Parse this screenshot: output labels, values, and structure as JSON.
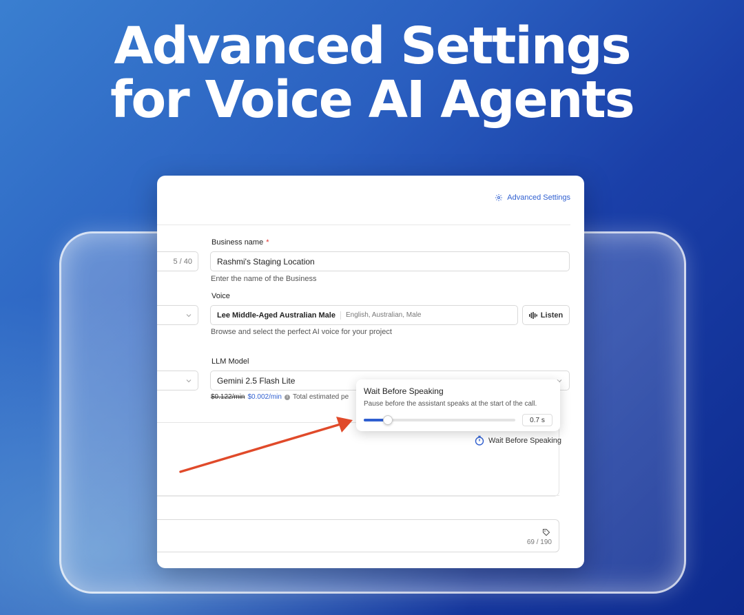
{
  "headline": {
    "line1": "Advanced Settings",
    "line2": "for Voice AI Agents"
  },
  "card": {
    "advanced_settings_link": "Advanced Settings",
    "left_counter": "5 / 40",
    "business_name": {
      "label": "Business name",
      "required_mark": "*",
      "value": "Rashmi's Staging Location",
      "helper": "Enter the name of the Business"
    },
    "voice": {
      "label": "Voice",
      "selected_name": "Lee Middle-Aged Australian Male",
      "selected_details": "English, Australian, Male",
      "listen_button": "Listen",
      "helper": "Browse and select the perfect AI voice for your project"
    },
    "llm_model": {
      "label": "LLM Model",
      "value": "Gemini 2.5 Flash Lite",
      "old_price": "$0.122/min",
      "new_price": "$0.002/min",
      "info_glyph": "i",
      "price_note": "Total estimated pe"
    },
    "wait_chip_label": "Wait Before Speaking",
    "textarea_counter": "69 / 190"
  },
  "popover": {
    "title": "Wait Before Speaking",
    "description": "Pause before the assistant speaks at the start of the call.",
    "slider_fraction": 0.16,
    "value_text": "0.7 s"
  },
  "colors": {
    "accent": "#2f5fd0",
    "arrow": "#e04a2a",
    "required": "#e0312c"
  },
  "icons": {
    "advanced_settings": "gear-icon",
    "listen": "waveform-icon",
    "wait": "stopwatch-icon",
    "tag": "tag-icon",
    "dropdown": "chevron-down-icon"
  }
}
